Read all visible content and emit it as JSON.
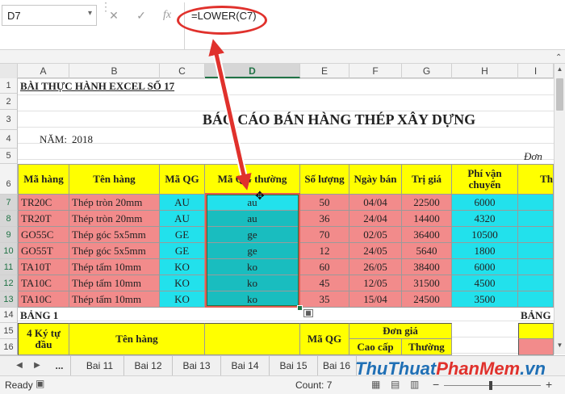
{
  "name_box": "D7",
  "formula": "=LOWER(C7)",
  "fx_label": "fx",
  "columns": [
    "A",
    "B",
    "C",
    "D",
    "E",
    "F",
    "G",
    "H",
    "I"
  ],
  "rows": [
    "1",
    "2",
    "3",
    "4",
    "5",
    "6",
    "7",
    "8",
    "9",
    "10",
    "11",
    "12",
    "13",
    "14",
    "15",
    "16"
  ],
  "title_row1": "BÀI THỰC HÀNH EXCEL SỐ 17",
  "report_title": "BÁO CÁO BÁN HÀNG THÉP XÂY DỰNG",
  "year_label": "NĂM:",
  "year_value": "2018",
  "unit_text": "Đơn",
  "headers": {
    "ma_hang": "Mã hàng",
    "ten_hang": "Tên hàng",
    "ma_qg": "Mã QG",
    "ma_qg_thuong": "Mã QG thường",
    "so_luong": "Số lượng",
    "ngay_ban": "Ngày bán",
    "tri_gia": "Trị giá",
    "phi_vc": "Phí vận chuyển",
    "col_i": "Th"
  },
  "table_rows": [
    {
      "ma": "TR20C",
      "ten": "Thép tròn 20mm",
      "qg": "AU",
      "qgl": "au",
      "sl": "50",
      "ngay": "04/04",
      "gia": "22500",
      "phi": "6000"
    },
    {
      "ma": "TR20T",
      "ten": "Thép tròn 20mm",
      "qg": "AU",
      "qgl": "au",
      "sl": "36",
      "ngay": "24/04",
      "gia": "14400",
      "phi": "4320"
    },
    {
      "ma": "GO55C",
      "ten": "Thép góc 5x5mm",
      "qg": "GE",
      "qgl": "ge",
      "sl": "70",
      "ngay": "02/05",
      "gia": "36400",
      "phi": "10500"
    },
    {
      "ma": "GO55T",
      "ten": "Thép góc 5x5mm",
      "qg": "GE",
      "qgl": "ge",
      "sl": "12",
      "ngay": "24/05",
      "gia": "5640",
      "phi": "1800"
    },
    {
      "ma": "TA10T",
      "ten": "Thép tấm 10mm",
      "qg": "KO",
      "qgl": "ko",
      "sl": "60",
      "ngay": "26/05",
      "gia": "38400",
      "phi": "6000"
    },
    {
      "ma": "TA10C",
      "ten": "Thép tấm 10mm",
      "qg": "KO",
      "qgl": "ko",
      "sl": "45",
      "ngay": "12/05",
      "gia": "31500",
      "phi": "4500"
    },
    {
      "ma": "TA10C",
      "ten": "Thép tấm 10mm",
      "qg": "KO",
      "qgl": "ko",
      "sl": "35",
      "ngay": "15/04",
      "gia": "24500",
      "phi": "3500"
    }
  ],
  "bang1": "BẢNG 1",
  "bang2": "BẢNG",
  "sub_headers": {
    "ky_tu": "4 Ký tự đầu",
    "ten_hang": "Tên hàng",
    "ma_qg": "Mã QG",
    "don_gia": "Đơn giá",
    "cao_cap": "Cao cấp",
    "thuong": "Thường"
  },
  "sheet_tabs": [
    "Bai 11",
    "Bai 12",
    "Bai 13",
    "Bai 14",
    "Bai 15",
    "Bai 16"
  ],
  "tab_more": "...",
  "status_ready": "Ready",
  "status_count": "Count: 7",
  "zoom_minus": "−",
  "zoom_plus": "+",
  "watermark": {
    "part1": "ThuThuat",
    "part2": "PhanMem",
    "part3": ".vn"
  },
  "colors": {
    "accent_red": "#e0312c",
    "excel_green": "#217346",
    "pink": "#f28b8b",
    "cyan": "#22e1ec",
    "teal": "#19bdbf",
    "yellow": "#ffff00"
  }
}
